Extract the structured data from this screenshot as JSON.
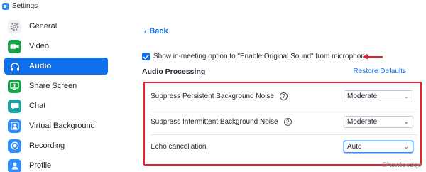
{
  "window": {
    "title": "Settings"
  },
  "sidebar": {
    "items": [
      {
        "label": "General",
        "icon": "gear-icon",
        "active": false
      },
      {
        "label": "Video",
        "icon": "video-camera-icon",
        "active": false
      },
      {
        "label": "Audio",
        "icon": "headphones-icon",
        "active": true
      },
      {
        "label": "Share Screen",
        "icon": "share-screen-icon",
        "active": false
      },
      {
        "label": "Chat",
        "icon": "chat-bubble-icon",
        "active": false
      },
      {
        "label": "Virtual Background",
        "icon": "person-portrait-icon",
        "active": false
      },
      {
        "label": "Recording",
        "icon": "record-icon",
        "active": false
      },
      {
        "label": "Profile",
        "icon": "profile-icon",
        "active": false
      }
    ]
  },
  "main": {
    "back_label": "Back",
    "original_sound_option": {
      "label": "Show in-meeting option to \"Enable Original Sound\" from microphone",
      "checked": true
    },
    "section_title": "Audio Processing",
    "restore_defaults_label": "Restore Defaults",
    "settings": [
      {
        "label": "Suppress Persistent Background Noise",
        "value": "Moderate",
        "has_help": true
      },
      {
        "label": "Suppress Intermittent Background Noise",
        "value": "Moderate",
        "has_help": true
      },
      {
        "label": "Echo cancellation",
        "value": "Auto",
        "has_help": false
      }
    ]
  },
  "watermark": "©howtoedge",
  "colors": {
    "accent": "#0e71eb",
    "highlight": "#e8202a"
  }
}
